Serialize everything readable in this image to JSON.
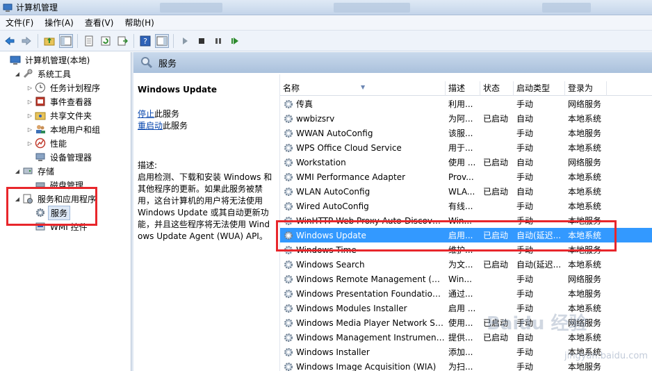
{
  "window": {
    "title": "计算机管理"
  },
  "menu": [
    {
      "label": "文件(F)"
    },
    {
      "label": "操作(A)"
    },
    {
      "label": "查看(V)"
    },
    {
      "label": "帮助(H)"
    }
  ],
  "toolbar": {
    "buttons": [
      "back-arrow-icon",
      "forward-arrow-icon",
      "up-folder-icon",
      "show-hide-tree-icon",
      "properties-icon",
      "refresh-icon",
      "export-list-icon",
      "help-icon",
      "show-hide-action-icon",
      "start-service-icon",
      "stop-service-icon",
      "pause-service-icon",
      "restart-service-icon"
    ]
  },
  "tree": {
    "items": [
      {
        "label": "计算机管理(本地)",
        "level": 0,
        "twisty": "",
        "icon": "computer-management-icon"
      },
      {
        "label": "系统工具",
        "level": 1,
        "twisty": "◢",
        "icon": "system-tools-icon"
      },
      {
        "label": "任务计划程序",
        "level": 2,
        "twisty": "▷",
        "icon": "clock-icon"
      },
      {
        "label": "事件查看器",
        "level": 2,
        "twisty": "▷",
        "icon": "event-viewer-icon"
      },
      {
        "label": "共享文件夹",
        "level": 2,
        "twisty": "▷",
        "icon": "shared-folder-icon"
      },
      {
        "label": "本地用户和组",
        "level": 2,
        "twisty": "▷",
        "icon": "users-icon"
      },
      {
        "label": "性能",
        "level": 2,
        "twisty": "▷",
        "icon": "performance-icon"
      },
      {
        "label": "设备管理器",
        "level": 2,
        "twisty": "",
        "icon": "device-manager-icon"
      },
      {
        "label": "存储",
        "level": 1,
        "twisty": "◢",
        "icon": "storage-icon"
      },
      {
        "label": "磁盘管理",
        "level": 2,
        "twisty": "",
        "icon": "disk-icon"
      },
      {
        "label": "服务和应用程序",
        "level": 1,
        "twisty": "◢",
        "icon": "services-apps-icon"
      },
      {
        "label": "服务",
        "level": 2,
        "twisty": "",
        "icon": "gear-icon",
        "selected": true
      },
      {
        "label": "WMI 控件",
        "level": 2,
        "twisty": "",
        "icon": "wmi-icon"
      }
    ]
  },
  "header": {
    "title": "服务"
  },
  "detail": {
    "service_title": "Windows Update",
    "stop_link": "停止",
    "stop_suffix": "此服务",
    "restart_link": "重启动",
    "restart_suffix": "此服务",
    "description": "描述:\n启用检测、下载和安装 Windows 和其他程序的更新。如果此服务被禁用，这台计算机的用户将无法使用 Windows Update 或其自动更新功能，并且这些程序将无法使用 Windows Update Agent (WUA) API。"
  },
  "list": {
    "columns": [
      "名称",
      "描述",
      "状态",
      "启动类型",
      "登录为"
    ],
    "rows": [
      {
        "name": "传真",
        "desc": "利用...",
        "status": "",
        "startup": "手动",
        "logon": "网络服务"
      },
      {
        "name": "wwbizsrv",
        "desc": "为阿...",
        "status": "已启动",
        "startup": "自动",
        "logon": "本地系统"
      },
      {
        "name": "WWAN AutoConfig",
        "desc": "该服...",
        "status": "",
        "startup": "手动",
        "logon": "本地服务"
      },
      {
        "name": "WPS Office Cloud Service",
        "desc": "用于...",
        "status": "",
        "startup": "手动",
        "logon": "本地系统"
      },
      {
        "name": "Workstation",
        "desc": "使用 ...",
        "status": "已启动",
        "startup": "自动",
        "logon": "网络服务"
      },
      {
        "name": "WMI Performance Adapter",
        "desc": "Prov...",
        "status": "",
        "startup": "手动",
        "logon": "本地系统"
      },
      {
        "name": "WLAN AutoConfig",
        "desc": "WLA...",
        "status": "已启动",
        "startup": "自动",
        "logon": "本地系统"
      },
      {
        "name": "Wired AutoConfig",
        "desc": "有线...",
        "status": "",
        "startup": "手动",
        "logon": "本地系统"
      },
      {
        "name": "WinHTTP Web Proxy Auto-Discovery Service",
        "desc": "Win...",
        "status": "",
        "startup": "手动",
        "logon": "本地服务"
      },
      {
        "name": "Windows Update",
        "desc": "启用...",
        "status": "已启动",
        "startup": "自动(延迟...",
        "logon": "本地系统",
        "selected": true
      },
      {
        "name": "Windows Time",
        "desc": "维护...",
        "status": "",
        "startup": "手动",
        "logon": "本地服务"
      },
      {
        "name": "Windows Search",
        "desc": "为文...",
        "status": "已启动",
        "startup": "自动(延迟...",
        "logon": "本地系统"
      },
      {
        "name": "Windows Remote Management (WS-Management)",
        "desc": "Win...",
        "status": "",
        "startup": "手动",
        "logon": "网络服务"
      },
      {
        "name": "Windows Presentation Foundation Font Cache",
        "desc": "通过...",
        "status": "",
        "startup": "手动",
        "logon": "本地服务"
      },
      {
        "name": "Windows Modules Installer",
        "desc": "启用 ...",
        "status": "",
        "startup": "手动",
        "logon": "本地系统"
      },
      {
        "name": "Windows Media Player Network Sharing Service",
        "desc": "使用...",
        "status": "已启动",
        "startup": "手动",
        "logon": "网络服务"
      },
      {
        "name": "Windows Management Instrumentation",
        "desc": "提供...",
        "status": "已启动",
        "startup": "自动",
        "logon": "本地系统"
      },
      {
        "name": "Windows Installer",
        "desc": "添加...",
        "status": "",
        "startup": "手动",
        "logon": "本地系统"
      },
      {
        "name": "Windows Image Acquisition (WIA)",
        "desc": "为扫...",
        "status": "",
        "startup": "手动",
        "logon": "本地服务"
      }
    ]
  },
  "watermark": {
    "brand": "Baidu 经验",
    "site": "jingyan.baidu.com"
  }
}
